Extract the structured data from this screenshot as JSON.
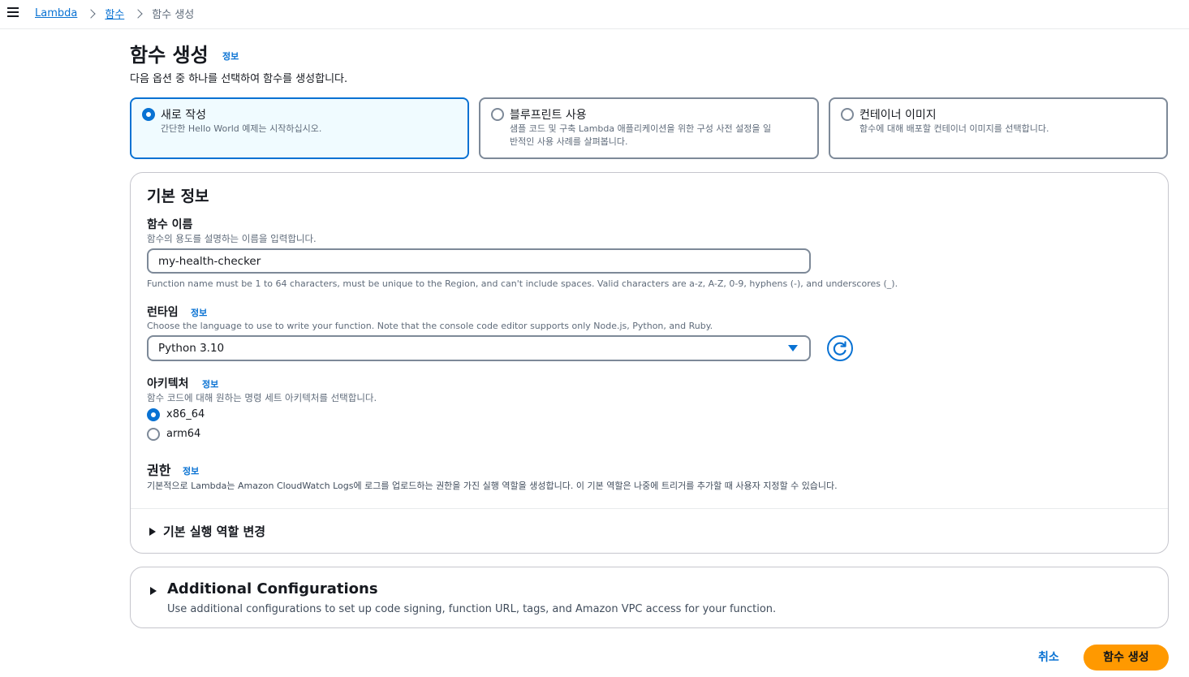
{
  "breadcrumb": {
    "items": [
      "Lambda",
      "함수"
    ],
    "current": "함수 생성"
  },
  "page": {
    "title": "함수 생성",
    "info": "정보",
    "description": "다음 옵션 중 하나를 선택하여 함수를 생성합니다."
  },
  "options": [
    {
      "title": "새로 작성",
      "desc": "간단한 Hello World 예제는 시작하십시오.",
      "selected": true
    },
    {
      "title": "블루프린트 사용",
      "desc_line1": "샘플 코드 및 구축 Lambda 애플리케이션을 위한 구성 사전 설정을 일",
      "desc_line2": "반적인 사용 사례를 살펴봅니다.",
      "selected": false
    },
    {
      "title": "컨테이너 이미지",
      "desc": "함수에 대해 배포할 컨테이너 이미지를 선택합니다.",
      "selected": false
    }
  ],
  "basic_info": {
    "title": "기본 정보",
    "function_name": {
      "label": "함수 이름",
      "desc": "함수의 용도를 설명하는 이름을 입력합니다.",
      "value": "my-health-checker",
      "constraint": "Function name must be 1 to 64 characters, must be unique to the Region, and can't include spaces. Valid characters are a-z, A-Z, 0-9, hyphens (-), and underscores (_)."
    },
    "runtime": {
      "label": "런타임",
      "info": "정보",
      "desc": "Choose the language to use to write your function. Note that the console code editor supports only Node.js, Python, and Ruby.",
      "selected": "Python 3.10"
    },
    "architecture": {
      "label": "아키텍처",
      "info": "정보",
      "desc": "함수 코드에 대해 원하는 명령 세트 아키텍처를 선택합니다.",
      "options": [
        {
          "label": "x86_64",
          "checked": true
        },
        {
          "label": "arm64",
          "checked": false
        }
      ]
    },
    "permissions": {
      "label": "권한",
      "info": "정보",
      "desc": "기본적으로 Lambda는 Amazon CloudWatch Logs에 로그를 업로드하는 권한을 가진 실행 역할을 생성합니다. 이 기본 역할은 나중에 트리거를 추가할 때 사용자 지정할 수 있습니다."
    },
    "execution_role_toggle": "기본 실행 역할 변경"
  },
  "additional": {
    "title": "Additional Configurations",
    "desc": "Use additional configurations to set up code signing, function URL, tags, and Amazon VPC access for your function."
  },
  "footer": {
    "cancel": "취소",
    "create": "함수 생성"
  },
  "colors": {
    "link": "#0972d3",
    "primary_button": "#ff9900",
    "selected_bg": "#f0fbff"
  }
}
